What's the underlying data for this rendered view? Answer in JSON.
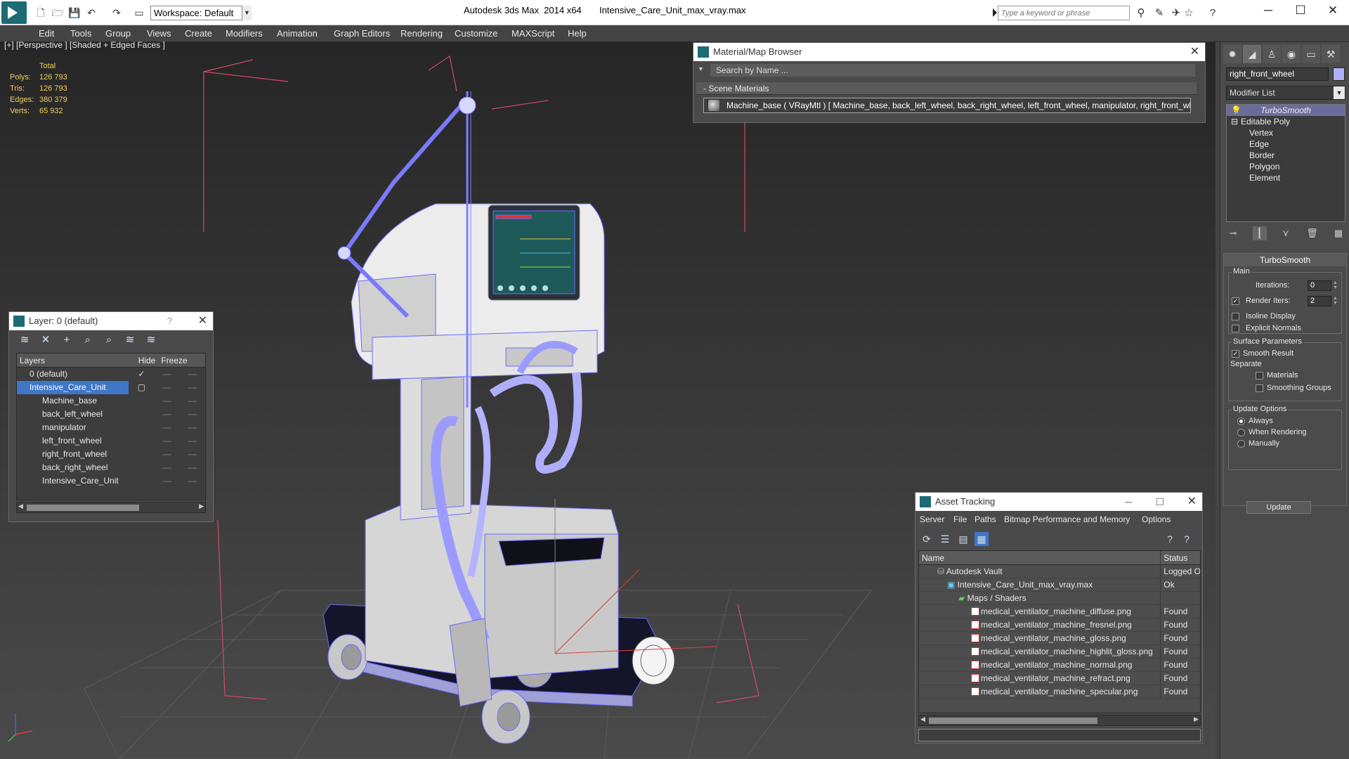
{
  "titlebar": {
    "workspace": "Workspace: Default",
    "app_title": "Autodesk 3ds Max  2014 x64",
    "file_title": "Intensive_Care_Unit_max_vray.max",
    "search_placeholder": "Type a keyword or phrase"
  },
  "menu": [
    "Edit",
    "Tools",
    "Group",
    "Views",
    "Create",
    "Modifiers",
    "Animation",
    "Graph Editors",
    "Rendering",
    "Customize",
    "MAXScript",
    "Help"
  ],
  "viewport": {
    "label": "[+] [Perspective ] [Shaded + Edged Faces ]",
    "stats_header": "Total",
    "stats": [
      {
        "label": "Polys:",
        "value": "126 793"
      },
      {
        "label": "Tris:",
        "value": "126 793"
      },
      {
        "label": "Edges:",
        "value": "380 379"
      },
      {
        "label": "Verts:",
        "value": "65 932"
      }
    ]
  },
  "layer_panel": {
    "title": "Layer: 0 (default)",
    "help": "?",
    "headers": {
      "layers": "Layers",
      "hide": "Hide",
      "freeze": "Freeze"
    },
    "rows": [
      {
        "name": "0 (default)",
        "indent": 1
      },
      {
        "name": "Intensive_Care_Unit",
        "indent": 1
      },
      {
        "name": "Machine_base",
        "indent": 2
      },
      {
        "name": "back_left_wheel",
        "indent": 2
      },
      {
        "name": "manipulator",
        "indent": 2
      },
      {
        "name": "left_front_wheel",
        "indent": 2
      },
      {
        "name": "right_front_wheel",
        "indent": 2
      },
      {
        "name": "back_right_wheel",
        "indent": 2
      },
      {
        "name": "Intensive_Care_Unit",
        "indent": 2
      }
    ]
  },
  "material_browser": {
    "title": "Material/Map Browser",
    "search": "Search by Name ...",
    "section": "- Scene Materials",
    "item": "Machine_base  ( VRayMtl )  [ Machine_base, back_left_wheel, back_right_wheel, left_front_wheel, manipulator, right_front_wheel]"
  },
  "asset_tracking": {
    "title": "Asset Tracking",
    "menu": [
      "Server",
      "File",
      "Paths",
      "Bitmap Performance and Memory",
      "Options"
    ],
    "headers": {
      "name": "Name",
      "status": "Status"
    },
    "rows": [
      {
        "name": "Autodesk Vault",
        "status": "Logged Ou",
        "indent": 1,
        "icon": "vault-icon"
      },
      {
        "name": "Intensive_Care_Unit_max_vray.max",
        "status": "Ok",
        "indent": 2,
        "icon": "max-file-icon"
      },
      {
        "name": "Maps / Shaders",
        "status": "",
        "indent": 3,
        "icon": "folder-icon"
      },
      {
        "name": "medical_ventilator_machine_diffuse.png",
        "status": "Found",
        "indent": 4,
        "icon": "png-icon"
      },
      {
        "name": "medical_ventilator_machine_fresnel.png",
        "status": "Found",
        "indent": 4,
        "icon": "png-icon"
      },
      {
        "name": "medical_ventilator_machine_gloss.png",
        "status": "Found",
        "indent": 4,
        "icon": "png-icon"
      },
      {
        "name": "medical_ventilator_machine_highlit_gloss.png",
        "status": "Found",
        "indent": 4,
        "icon": "png-icon"
      },
      {
        "name": "medical_ventilator_machine_normal.png",
        "status": "Found",
        "indent": 4,
        "icon": "png-icon"
      },
      {
        "name": "medical_ventilator_machine_refract.png",
        "status": "Found",
        "indent": 4,
        "icon": "png-icon"
      },
      {
        "name": "medical_ventilator_machine_specular.png",
        "status": "Found",
        "indent": 4,
        "icon": "png-icon"
      }
    ]
  },
  "command_panel": {
    "object_name": "right_front_wheel",
    "modifier_list": "Modifier List",
    "stack": {
      "top": "TurboSmooth",
      "base": "Editable Poly",
      "subs": [
        "Vertex",
        "Edge",
        "Border",
        "Polygon",
        "Element"
      ]
    },
    "rollout_title": "TurboSmooth",
    "main_group": "Main",
    "iterations_label": "Iterations:",
    "iterations_value": "0",
    "render_iters_label": "Render Iters:",
    "render_iters_value": "2",
    "isoline": "Isoline Display",
    "explicit_normals": "Explicit Normals",
    "surface_group": "Surface Parameters",
    "smooth_result": "Smooth Result",
    "separate_label": "Separate",
    "materials": "Materials",
    "smoothing_groups": "Smoothing Groups",
    "update_group": "Update Options",
    "always": "Always",
    "when_rendering": "When Rendering",
    "manually": "Manually",
    "update_button": "Update"
  }
}
